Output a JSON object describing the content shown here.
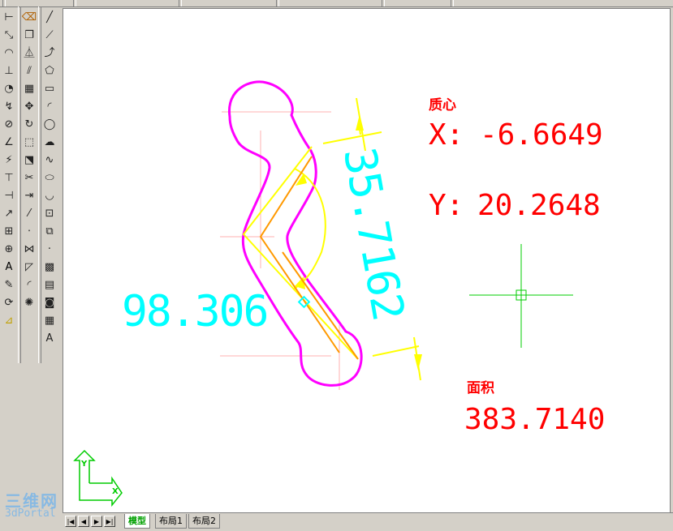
{
  "ucs_axes": {
    "x_label": "X",
    "y_label": "Y"
  },
  "centroid": {
    "title": "质心",
    "x_label": "X:",
    "x_value": "-6.6649",
    "y_label": "Y:",
    "y_value": "20.2648"
  },
  "area": {
    "title": "面积",
    "value": "383.7140"
  },
  "dimensions": {
    "aligned": "35.7162",
    "angular": "98.306"
  },
  "layout_tabs": [
    {
      "label": "模型",
      "active": true
    },
    {
      "label": "布局1",
      "active": false
    },
    {
      "label": "布局2",
      "active": false
    }
  ],
  "tab_nav": [
    "first",
    "prev",
    "next",
    "last"
  ],
  "watermark": {
    "cn": "三维网",
    "en": "3dPortal"
  },
  "colors": {
    "profile": "#ff00ff",
    "dimension": "#00ffff",
    "construction": "#ffff00",
    "inner": "#ff9900",
    "annotation": "#ff0000",
    "crosshair": "#00cc00",
    "centerline": "#ffb0b0"
  },
  "toolbars": {
    "draw_col1": [
      "dim-linear-icon",
      "dim-aligned-icon",
      "dim-arc-icon",
      "dim-ordinate-icon",
      "dim-radius-icon",
      "dim-jogged-icon",
      "dim-diameter-icon",
      "dim-angular-icon",
      "quick-dim-icon",
      "dim-baseline-icon",
      "dim-continue-icon",
      "qleader-icon",
      "tolerance-icon",
      "center-mark-icon",
      "dim-edit-icon",
      "dim-text-edit-icon",
      "dim-update-icon",
      "dim-style-icon"
    ],
    "modify_col": [
      "erase-icon",
      "copy-icon",
      "mirror-icon",
      "offset-icon",
      "array-icon",
      "move-icon",
      "rotate-icon",
      "scale-icon",
      "stretch-icon",
      "trim-icon",
      "extend-icon",
      "break-icon",
      "break-at-point-icon",
      "join-icon",
      "chamfer-icon",
      "fillet-icon",
      "explode-icon"
    ],
    "draw_col2": [
      "line-icon",
      "construction-line-icon",
      "polyline-icon",
      "polygon-icon",
      "rectangle-icon",
      "arc-icon",
      "circle-icon",
      "revision-cloud-icon",
      "spline-icon",
      "ellipse-icon",
      "ellipse-arc-icon",
      "insert-block-icon",
      "make-block-icon",
      "point-icon",
      "hatch-icon",
      "gradient-icon",
      "region-icon",
      "table-icon",
      "multiline-text-icon"
    ]
  }
}
